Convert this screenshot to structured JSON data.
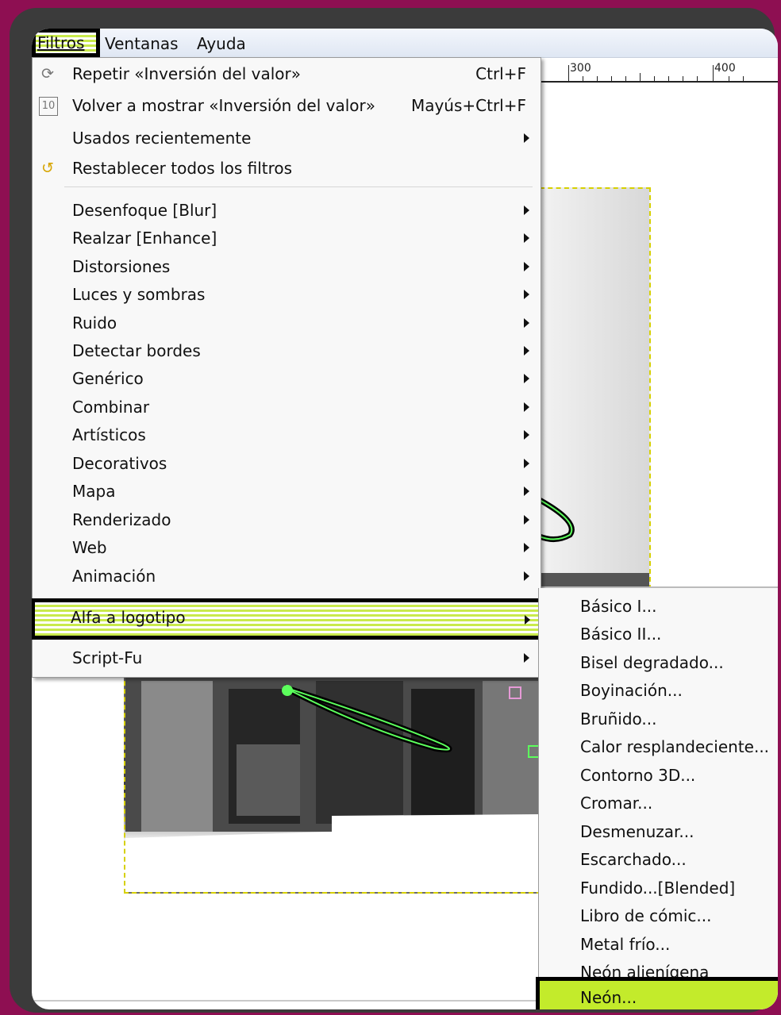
{
  "menubar": {
    "items": [
      "Filtros",
      "Ventanas",
      "Ayuda"
    ]
  },
  "ruler": {
    "labels": [
      "300",
      "400"
    ]
  },
  "filters_menu": {
    "top_items": [
      {
        "label": "Repetir «Inversión del valor»",
        "accel": "Ctrl+F",
        "icon": "repeat-icon"
      },
      {
        "label": "Volver a mostrar «Inversión del valor»",
        "accel": "Mayús+Ctrl+F",
        "icon": "reshow-icon"
      },
      {
        "label": "Usados recientemente",
        "submenu": true
      },
      {
        "label": "Restablecer todos los filtros",
        "icon": "reset-icon"
      }
    ],
    "categories": [
      "Desenfoque [Blur]",
      "Realzar [Enhance]",
      "Distorsiones",
      "Luces y sombras",
      "Ruido",
      "Detectar bordes",
      "Genérico",
      "Combinar",
      "Artísticos",
      "Decorativos",
      "Mapa",
      "Renderizado",
      "Web",
      "Animación"
    ],
    "highlighted": "Alfa a logotipo",
    "script_fu": "Script-Fu"
  },
  "submenu": {
    "items": [
      "Básico I...",
      "Básico II...",
      "Bisel degradado...",
      "Boyinación...",
      "Bruñido...",
      "Calor resplandeciente...",
      "Contorno 3D...",
      "Cromar...",
      "Desmenuzar...",
      "Escarchado...",
      "Fundido...[Blended]",
      "Libro de cómic...",
      "Metal frío...",
      "Neón alienígena"
    ],
    "highlighted": "Neón..."
  },
  "colors": {
    "highlight": "#c3eb2b",
    "background": "#8e0f52"
  }
}
